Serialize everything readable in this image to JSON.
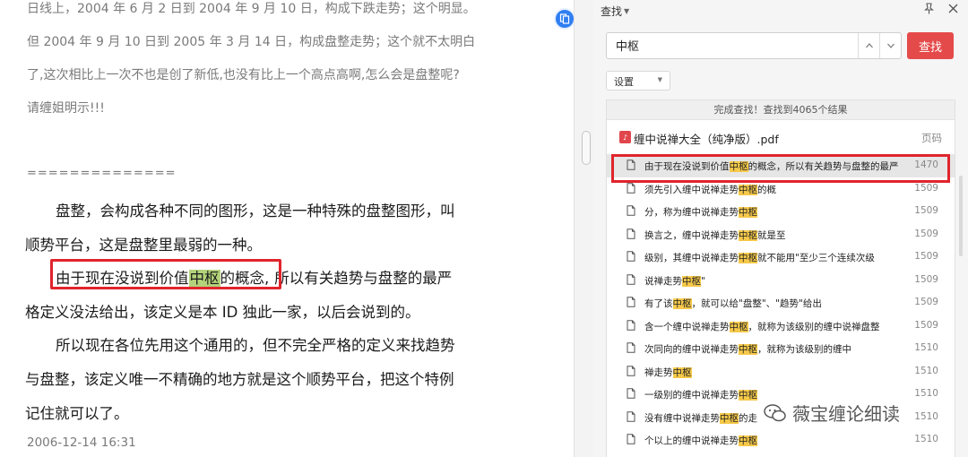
{
  "document": {
    "top_lines": [
      "日线上，2004 年 6 月 2 日到 2004 年 9 月 10 日，构成下跌走势；这个明显。",
      "但 2004 年 9 月 10 日到 2005 年 3 月 14 日，构成盘整走势；这个就不太明白",
      "了,这次相比上一次不也是创了新低,也没有比上一个高点高啊,怎么会是盘整呢?",
      "请缠姐明示!!!"
    ],
    "separator": "==============",
    "para1_line1": "盘整，会构成各种不同的图形，这是一种特殊的盘整图形，叫",
    "para1_line2": "顺势平台，这是盘整里最弱的一种。",
    "para2_line1_pre": "由于现在没说到价值",
    "para2_line1_hl": "中枢",
    "para2_line1_mid": "的概念,",
    "para2_line1_post": "所以有关趋势与盘整的最严",
    "para2_line2": "格定义没法给出，该定义是本 ID 独此一家，以后会说到的。",
    "para3_line1": "所以现在各位先用这个通用的，但不完全严格的定义来找趋势",
    "para3_line2": "与盘整，该定义唯一不精确的地方就是这个顺势平台，把这个特例",
    "para3_line3": "记住就可以了。",
    "date": "2006-12-14  16:31"
  },
  "panel": {
    "title": "查找",
    "search_value": "中枢",
    "find_label": "查找",
    "settings_label": "设置",
    "status": "完成查找！查找到4065个结果",
    "file_name": "缠中说禅大全（纯净版）.pdf",
    "page_col": "页码",
    "results": [
      {
        "pre": "由于现在没说到价值",
        "hit": "中枢",
        "post": "的概念，所以有关趋势与盘整的最严",
        "page": "1470",
        "selected": true
      },
      {
        "pre": "须先引入缠中说禅走势",
        "hit": "中枢",
        "post": "的概",
        "page": "1509"
      },
      {
        "pre": "分，称为缠中说禅走势",
        "hit": "中枢",
        "post": "",
        "page": "1509"
      },
      {
        "pre": "换言之，缠中说禅走势",
        "hit": "中枢",
        "post": "就是至",
        "page": "1509"
      },
      {
        "pre": "级别，其缠中说禅走势",
        "hit": "中枢",
        "post": "就不能用\"至少三个连续次级",
        "page": "1509"
      },
      {
        "pre": "说禅走势",
        "hit": "中枢",
        "post": "\"",
        "page": "1509"
      },
      {
        "pre": "有了该",
        "hit": "中枢",
        "post": "，就可以给\"盘整\"、\"趋势\"给出",
        "page": "1509"
      },
      {
        "pre": "含一个缠中说禅走势",
        "hit": "中枢",
        "post": "，就称为该级别的缠中说禅盘整",
        "page": "1509"
      },
      {
        "pre": "次同向的缠中说禅走势",
        "hit": "中枢",
        "post": "，就称为该级别的缠中",
        "page": "1510"
      },
      {
        "pre": "禅走势",
        "hit": "中枢",
        "post": "",
        "page": "1510"
      },
      {
        "pre": "一级别的缠中说禅走势",
        "hit": "中枢",
        "post": "",
        "page": "1510"
      },
      {
        "pre": "没有缠中说禅走势",
        "hit": "中枢",
        "post": "的走",
        "page": "1510"
      },
      {
        "pre": "个以上的缠中说禅走势",
        "hit": "中枢",
        "post": "",
        "page": "1510"
      }
    ]
  },
  "watermark": "薇宝缠论细读",
  "colors": {
    "accent_red": "#e54a4a",
    "highlight_red_box": "#e0242c",
    "search_hit": "#f6c94a",
    "doc_hit": "#b3d27a"
  }
}
